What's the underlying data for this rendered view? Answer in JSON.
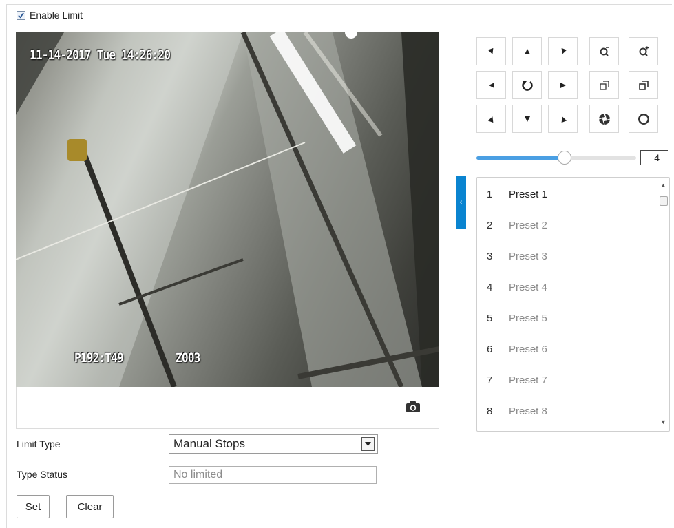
{
  "enable_limit": {
    "label": "Enable Limit",
    "checked": true
  },
  "video": {
    "timestamp": "11-14-2017 Tue 14:26:20",
    "ptz_position": "P192:T49",
    "zoom_value": "Z003"
  },
  "speed": {
    "value": "4",
    "fraction": 0.55
  },
  "presets": [
    {
      "num": "1",
      "name": "Preset 1"
    },
    {
      "num": "2",
      "name": "Preset 2"
    },
    {
      "num": "3",
      "name": "Preset 3"
    },
    {
      "num": "4",
      "name": "Preset 4"
    },
    {
      "num": "5",
      "name": "Preset 5"
    },
    {
      "num": "6",
      "name": "Preset 6"
    },
    {
      "num": "7",
      "name": "Preset 7"
    },
    {
      "num": "8",
      "name": "Preset 8"
    }
  ],
  "form": {
    "limit_type_label": "Limit Type",
    "limit_type_value": "Manual Stops",
    "type_status_label": "Type Status",
    "type_status_value": "No limited"
  },
  "buttons": {
    "set": "Set",
    "clear": "Clear"
  },
  "colors": {
    "accent": "#0a84d0",
    "slider_fill": "#4a9fe3"
  }
}
